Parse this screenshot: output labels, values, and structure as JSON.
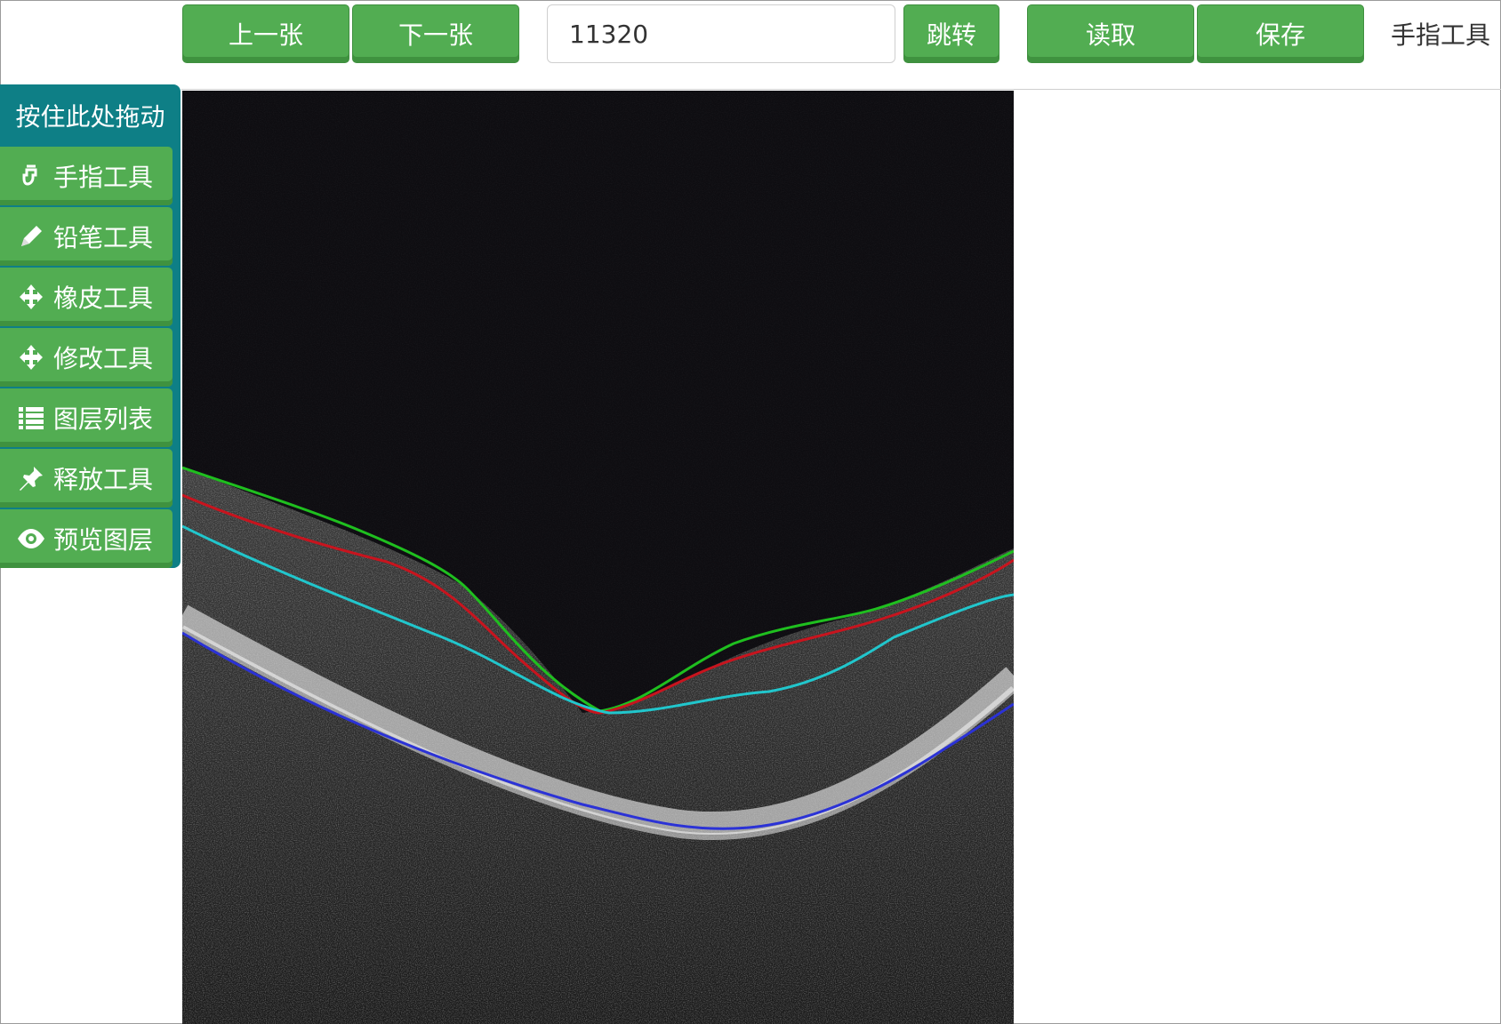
{
  "toolbar": {
    "prev_label": "上一张",
    "next_label": "下一张",
    "image_number": "11320",
    "jump_label": "跳转",
    "read_label": "读取",
    "save_label": "保存",
    "current_tool": "手指工具"
  },
  "panel": {
    "drag_label": "按住此处拖动",
    "tools": [
      {
        "label": "手指工具",
        "icon": "hand-pointer-icon"
      },
      {
        "label": "铅笔工具",
        "icon": "pencil-icon"
      },
      {
        "label": "橡皮工具",
        "icon": "crosshair-move-icon"
      },
      {
        "label": "修改工具",
        "icon": "crosshair-move-icon"
      },
      {
        "label": "图层列表",
        "icon": "list-icon"
      },
      {
        "label": "释放工具",
        "icon": "pin-icon"
      },
      {
        "label": "预览图层",
        "icon": "eye-icon"
      }
    ]
  },
  "colors": {
    "button_green": "#52ad52",
    "panel_teal": "#0e7f86",
    "layer_green": "#1fbf1f",
    "layer_red": "#c8141e",
    "layer_cyan": "#21c6cc",
    "layer_blue": "#2b32d6"
  }
}
